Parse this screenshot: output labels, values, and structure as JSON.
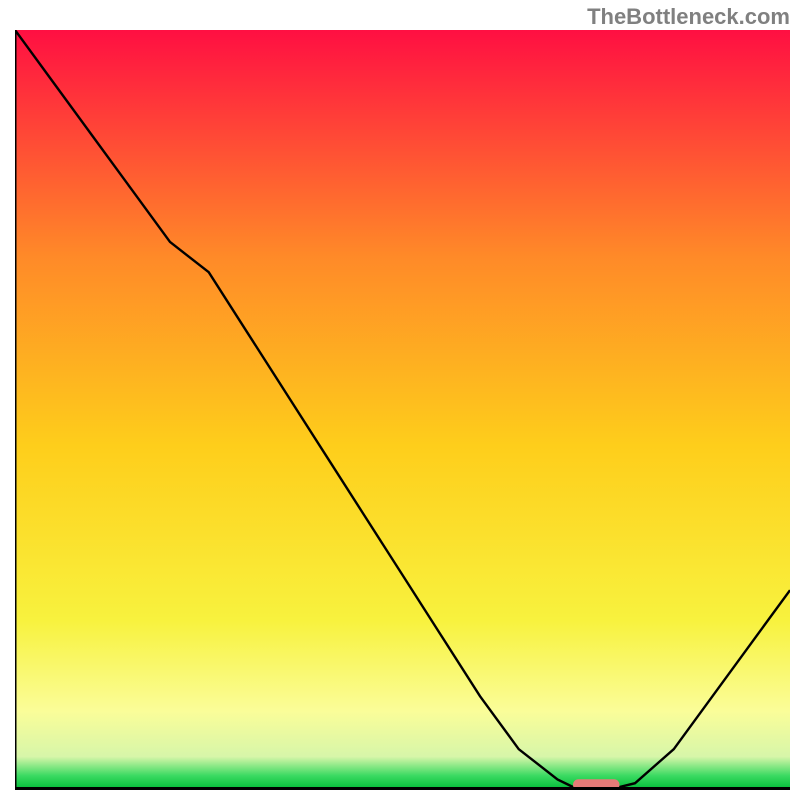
{
  "watermark": "TheBottleneck.com",
  "chart_data": {
    "type": "line",
    "title": "",
    "xlabel": "",
    "ylabel": "",
    "xlim": [
      0,
      100
    ],
    "ylim": [
      0,
      100
    ],
    "background_gradient": {
      "top": "#ff0f42",
      "upper_mid": "#ff8a28",
      "mid": "#fece1b",
      "lower_mid": "#f8f23e",
      "lower": "#fafd99",
      "green": "#3bda62",
      "bottom": "#0cc13f"
    },
    "curve": {
      "color": "#000000",
      "width": 2,
      "x": [
        0,
        5,
        10,
        15,
        20,
        25,
        30,
        35,
        40,
        45,
        50,
        55,
        60,
        65,
        70,
        72,
        75,
        78,
        80,
        85,
        90,
        95,
        100
      ],
      "y": [
        100,
        93,
        86,
        79,
        72,
        68,
        60,
        52,
        44,
        36,
        28,
        20,
        12,
        5,
        1,
        0,
        0,
        0,
        0.5,
        5,
        12,
        19,
        26
      ]
    },
    "marker": {
      "x_center": 75,
      "y": 0.3,
      "width": 6,
      "color": "#e67b78"
    },
    "axis_frame": {
      "visible_left": true,
      "visible_bottom": true,
      "color": "#000000",
      "width": 3
    }
  }
}
